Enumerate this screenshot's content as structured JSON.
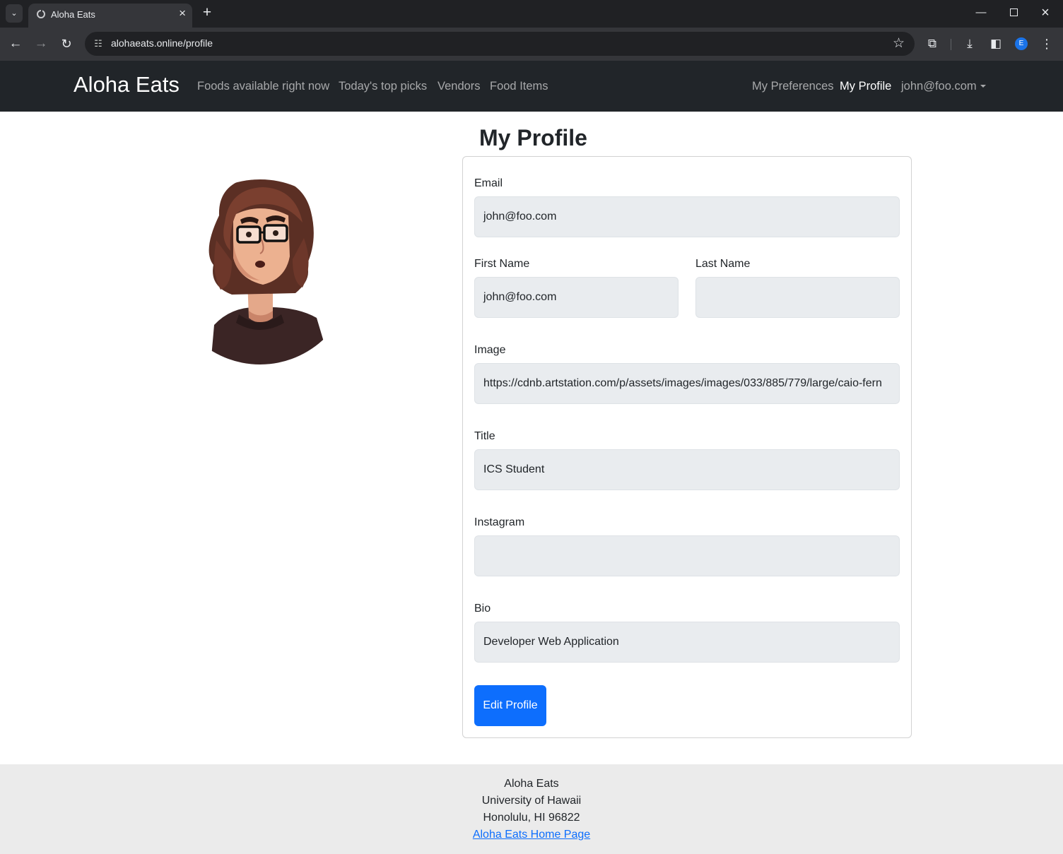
{
  "browser": {
    "tab_title": "Aloha Eats",
    "url": "alohaeats.online/profile",
    "profile_initial": "E"
  },
  "navbar": {
    "brand": "Aloha Eats",
    "links": [
      "Foods available right now",
      "Today's top picks",
      "Vendors",
      "Food Items"
    ],
    "right_links": {
      "preferences": "My Preferences",
      "profile": "My Profile",
      "user": "john@foo.com"
    }
  },
  "profile": {
    "heading": "My Profile",
    "email_label": "Email",
    "email_value": "john@foo.com",
    "first_name_label": "First Name",
    "first_name_value": "john@foo.com",
    "last_name_label": "Last Name",
    "last_name_value": "",
    "image_label": "Image",
    "image_value": "https://cdnb.artstation.com/p/assets/images/images/033/885/779/large/caio-fern",
    "title_label": "Title",
    "title_value": "ICS Student",
    "instagram_label": "Instagram",
    "instagram_value": "",
    "bio_label": "Bio",
    "bio_value": "Developer Web Application",
    "edit_button": "Edit Profile"
  },
  "footer": {
    "line1": "Aloha Eats",
    "line2": "University of Hawaii",
    "line3": "Honolulu, HI 96822",
    "link": "Aloha Eats Home Page"
  }
}
